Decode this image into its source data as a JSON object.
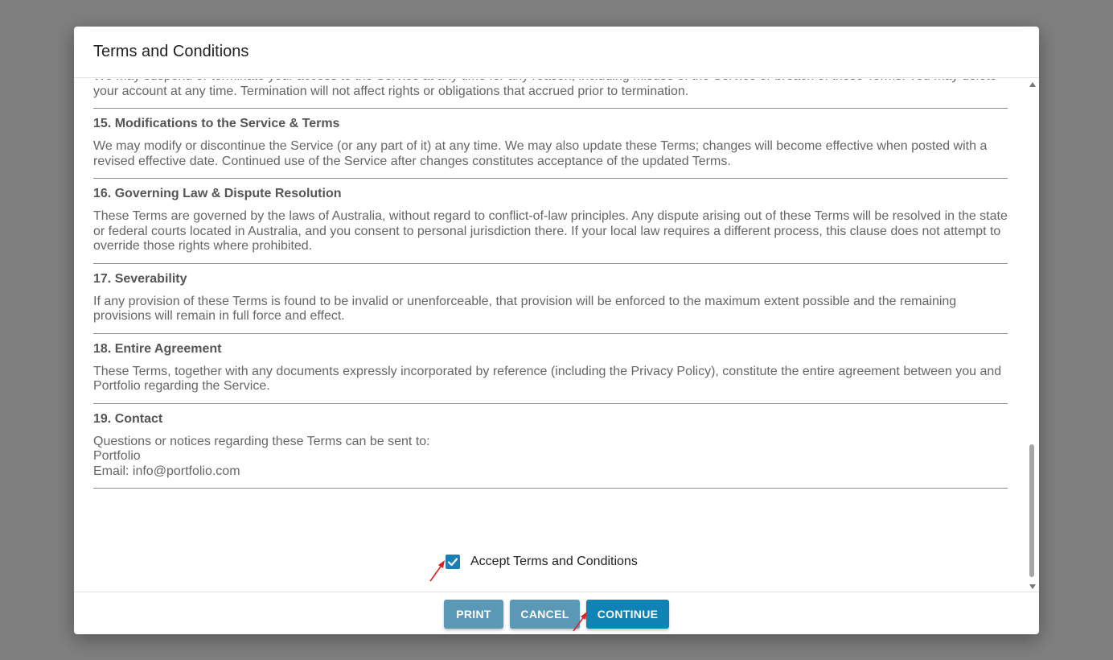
{
  "dialog": {
    "title": "Terms and Conditions"
  },
  "content": {
    "partial_top_text": "We may suspend or terminate your access to the Service at any time for any reason, including misuse of the Service or breach of these Terms. You may delete your account at any time. Termination will not affect rights or obligations that accrued prior to termination.",
    "sections": [
      {
        "heading": "15. Modifications to the Service & Terms",
        "body": "We may modify or discontinue the Service (or any part of it) at any time. We may also update these Terms; changes will become effective when posted with a revised effective date. Continued use of the Service after changes constitutes acceptance of the updated Terms."
      },
      {
        "heading": "16. Governing Law & Dispute Resolution",
        "body": "These Terms are governed by the laws of Australia, without regard to conflict-of-law principles. Any dispute arising out of these Terms will be resolved in the state or federal courts located in Australia, and you consent to personal jurisdiction there. If your local law requires a different process, this clause does not attempt to override those rights where prohibited."
      },
      {
        "heading": "17. Severability",
        "body": "If any provision of these Terms is found to be invalid or unenforceable, that provision will be enforced to the maximum extent possible and the remaining provisions will remain in full force and effect."
      },
      {
        "heading": "18. Entire Agreement",
        "body": "These Terms, together with any documents expressly incorporated by reference (including the Privacy Policy), constitute the entire agreement between you and Portfolio regarding the Service."
      },
      {
        "heading": "19. Contact",
        "body_lines": [
          "Questions or notices regarding these Terms can be sent to:",
          "Portfolio",
          "Email: info@portfolio.com"
        ]
      }
    ]
  },
  "accept": {
    "label": "Accept Terms and Conditions",
    "checked": true
  },
  "footer": {
    "print_label": "PRINT",
    "cancel_label": "CANCEL",
    "continue_label": "CONTINUE"
  },
  "colors": {
    "overlay": "#7f7f7f",
    "secondary_button": "#5b98b5",
    "primary_button": "#0f83b3",
    "checkbox": "#1a7fb5",
    "annotation_arrow": "#e02020"
  }
}
